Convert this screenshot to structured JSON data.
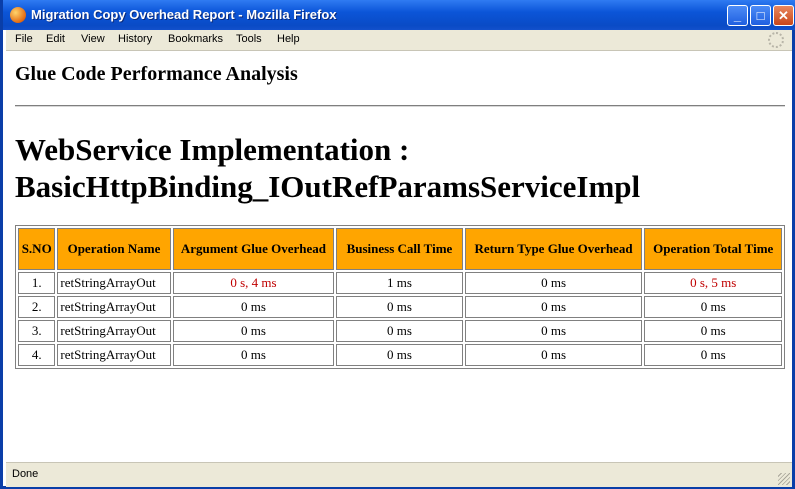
{
  "window": {
    "title": "Migration Copy Overhead Report - Mozilla Firefox",
    "minimize": "_",
    "maximize": "□",
    "close": "✕"
  },
  "menu": [
    "File",
    "Edit",
    "View",
    "History",
    "Bookmarks",
    "Tools",
    "Help"
  ],
  "page": {
    "heading": "Glue Code Performance Analysis",
    "title": "WebService Implementation : BasicHttpBinding_IOutRefParamsServiceImpl"
  },
  "table": {
    "headers": [
      "S.NO",
      "Operation Name",
      "Argument Glue Overhead",
      "Business Call Time",
      "Return Type Glue Overhead",
      "Operation Total Time"
    ],
    "rows": [
      {
        "sno": "1.",
        "op": "retStringArrayOut",
        "arg": "0 s, 4 ms",
        "call": "1 ms",
        "ret": "0 ms",
        "total": "0 s, 5 ms"
      },
      {
        "sno": "2.",
        "op": "retStringArrayOut",
        "arg": "0 ms",
        "call": "0 ms",
        "ret": "0 ms",
        "total": "0 ms"
      },
      {
        "sno": "3.",
        "op": "retStringArrayOut",
        "arg": "0 ms",
        "call": "0 ms",
        "ret": "0 ms",
        "total": "0 ms"
      },
      {
        "sno": "4.",
        "op": "retStringArrayOut",
        "arg": "0 ms",
        "call": "0 ms",
        "ret": "0 ms",
        "total": "0 ms"
      }
    ]
  },
  "status": "Done",
  "colors": {
    "header_bg": "#ffa500",
    "highlight_text": "#c00000",
    "titlebar": "#0b55d8"
  }
}
